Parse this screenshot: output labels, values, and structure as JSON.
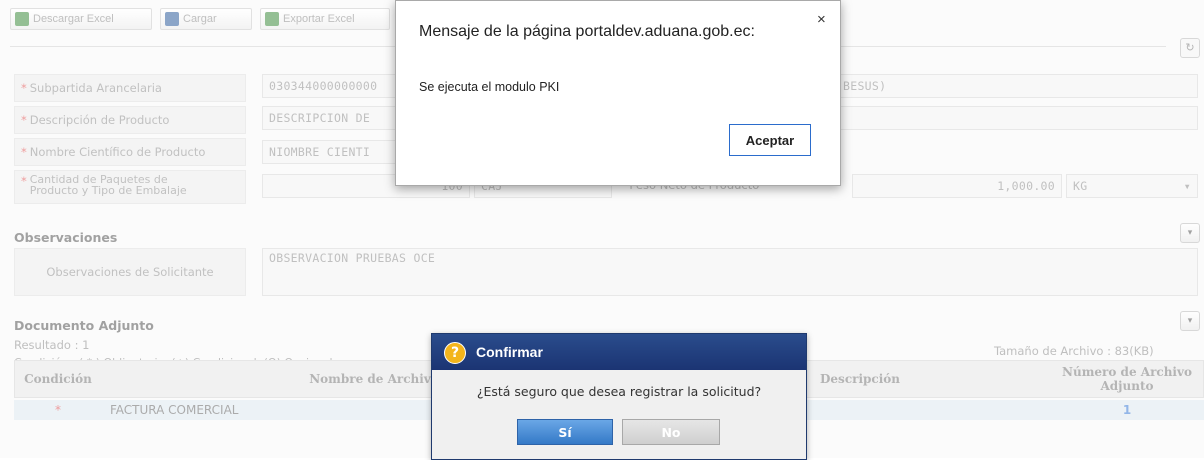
{
  "toolbar": {
    "descargar_excel": "Descargar Excel",
    "cargar": "Cargar",
    "exportar_excel": "Exportar Excel"
  },
  "form": {
    "subpartida_label": "Subpartida Arancelaria",
    "subpartida_value": "030344000000000",
    "subpartida_extra": "BESUS)",
    "descripcion_label": "Descripción de Producto",
    "descripcion_value": "DESCRIPCION DE",
    "nombre_label": "Nombre Científico de Producto",
    "nombre_value": "NIOMBRE CIENTI",
    "cantidad_label_1": "Cantidad de Paquetes de",
    "cantidad_label_2": "Producto y Tipo de Embalaje",
    "cantidad_value": "100",
    "embalaje_value": "CAJ",
    "peso_label": "Peso Neto de Producto",
    "peso_value": "1,000.00",
    "peso_unit": "KG",
    "required_mark": "*"
  },
  "observaciones": {
    "section_title": "Observaciones",
    "label": "Observaciones de Solicitante",
    "value": "OBSERVACION PRUEBAS OCE"
  },
  "adjunto": {
    "section_title": "Documento Adjunto",
    "resultado": "Resultado : 1",
    "condicion": "Condición : ( * ) Obligatorio, (+) Condicional, (O) Opcional",
    "tamano": "Tamaño de Archivo : 83(KB)",
    "columns": [
      "Condición",
      "Nombre de Archivo",
      "Descripción",
      "Número de Archivo",
      "Adjunto"
    ],
    "rows": [
      {
        "condicion": "*",
        "nombre": "FACTURA COMERCIAL",
        "numero": "1"
      }
    ]
  },
  "alert": {
    "title": "Mensaje de la página portaldev.aduana.gob.ec:",
    "close": "×",
    "message": "Se ejecuta el modulo PKI",
    "accept": "Aceptar"
  },
  "confirm": {
    "icon": "?",
    "title": "Confirmar",
    "message": "¿Está seguro que desea registrar la solicitud?",
    "yes": "Sí",
    "no": "No"
  },
  "icons": {
    "refresh": "↻",
    "chevron": "▾",
    "dropdown": "▾"
  }
}
